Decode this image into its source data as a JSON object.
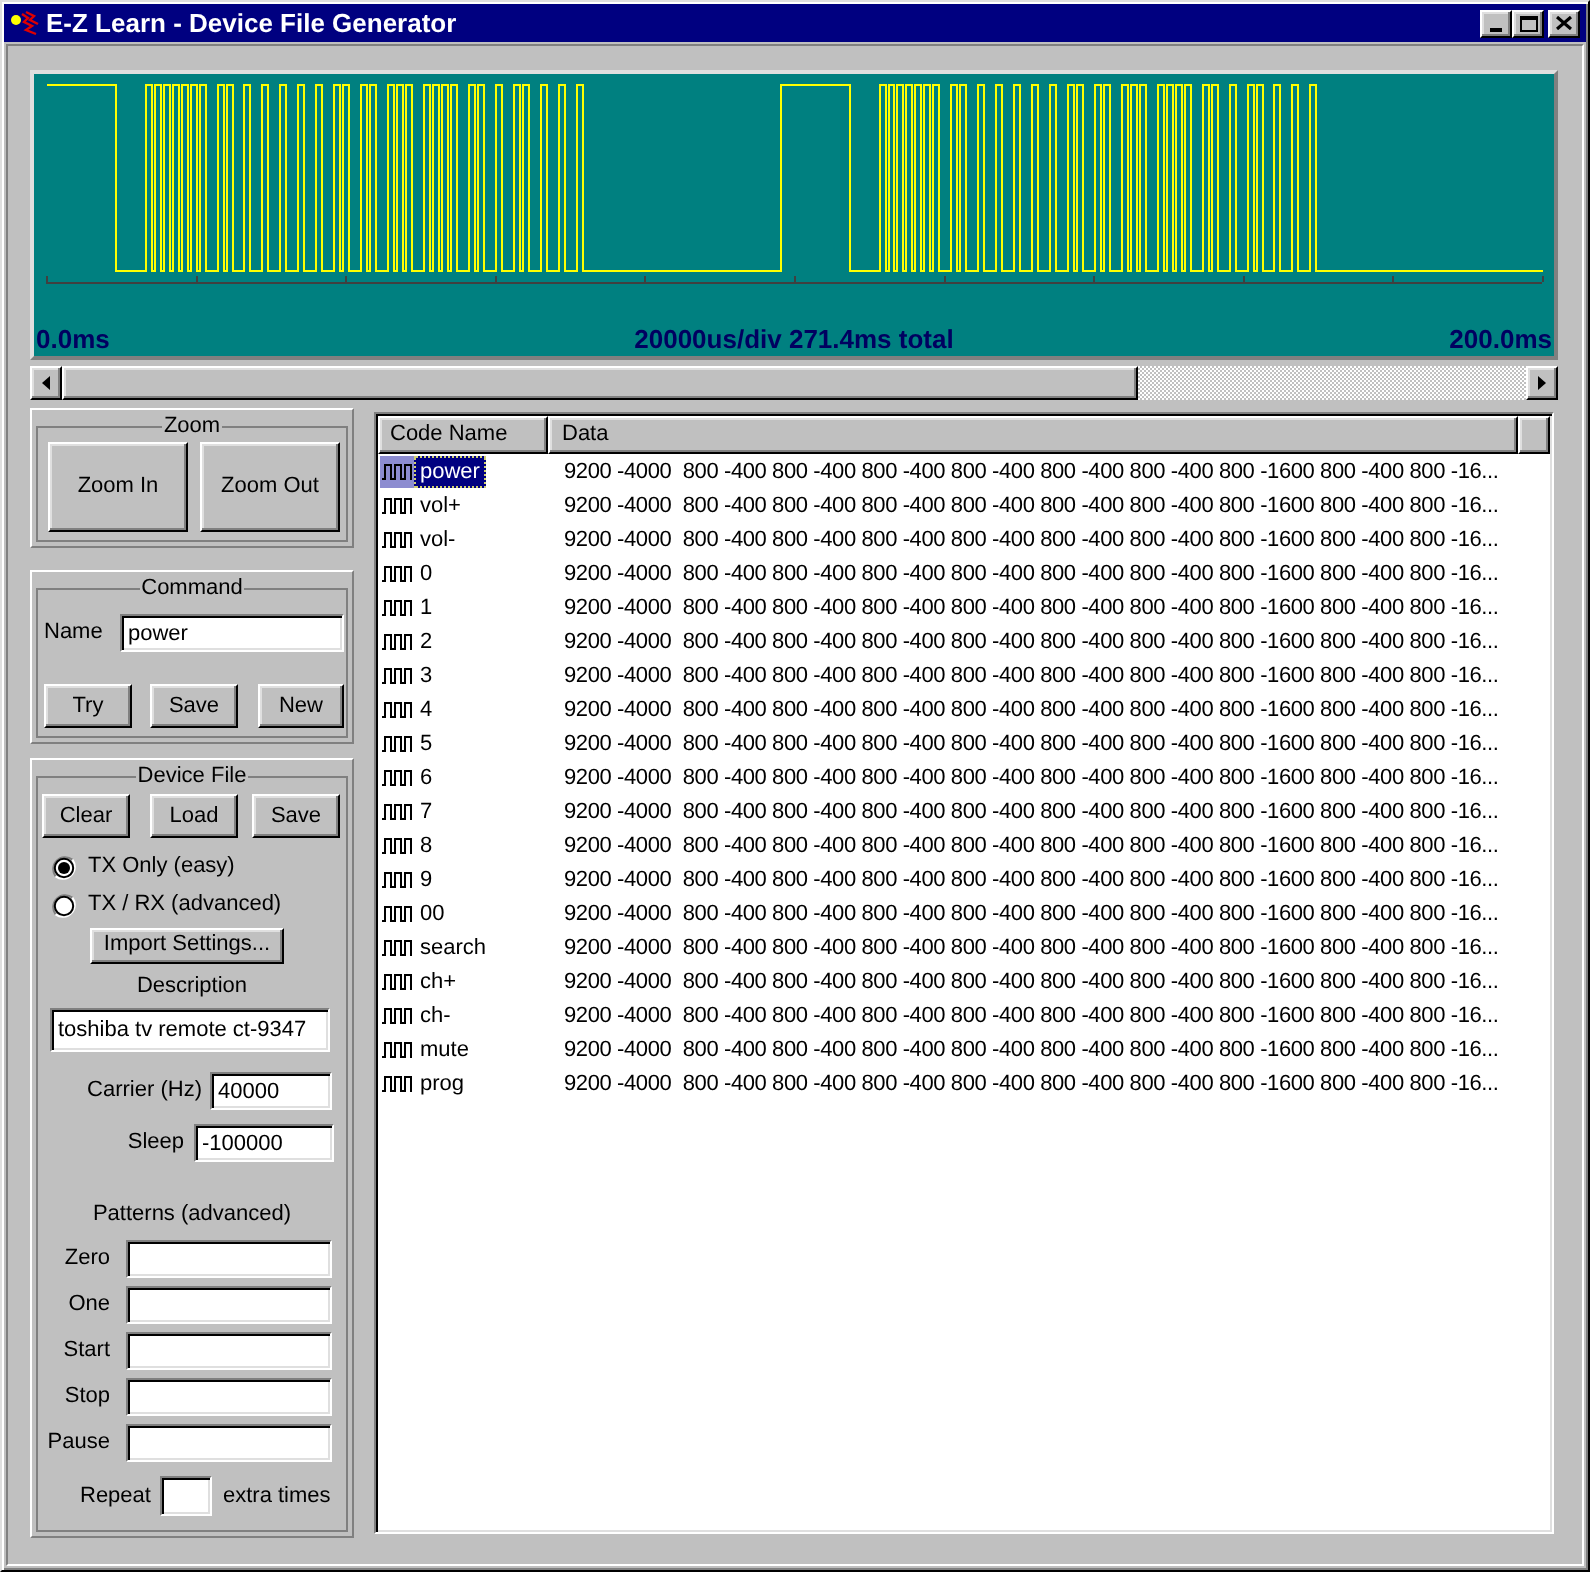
{
  "window": {
    "title": "E-Z Learn - Device File Generator"
  },
  "waveform": {
    "start_label": "0.0ms",
    "scale_label": "20000us/div 271.4ms total",
    "end_label": "200.0ms"
  },
  "zoom": {
    "title": "Zoom",
    "buttons": [
      "Zoom In",
      "Zoom Out"
    ]
  },
  "command": {
    "title": "Command",
    "name_label": "Name",
    "name_value": "power",
    "buttons": [
      "Try",
      "Save",
      "New"
    ]
  },
  "device_file": {
    "title": "Device File",
    "buttons": [
      "Clear",
      "Load",
      "Save"
    ],
    "modes": [
      {
        "label": "TX Only (easy)",
        "selected": true
      },
      {
        "label": "TX / RX (advanced)",
        "selected": false
      }
    ],
    "import_button": "Import Settings...",
    "description_label": "Description",
    "description_value": "toshiba tv remote ct-9347",
    "carrier_label": "Carrier (Hz)",
    "carrier_value": "40000",
    "sleep_label": "Sleep",
    "sleep_value": "-100000",
    "patterns_title": "Patterns (advanced)",
    "patterns": [
      {
        "label": "Zero"
      },
      {
        "label": "One"
      },
      {
        "label": "Start"
      },
      {
        "label": "Stop"
      },
      {
        "label": "Pause"
      }
    ],
    "repeat_label": "Repeat",
    "repeat_suffix": "extra times"
  },
  "table": {
    "columns": [
      "Code Name",
      "Data"
    ],
    "rows": [
      {
        "name": "power",
        "data": "9200 -4000  800 -400 800 -400 800 -400 800 -400 800 -400 800 -400 800 -1600 800 -400 800 -16...",
        "selected": true
      },
      {
        "name": "vol+",
        "data": "9200 -4000  800 -400 800 -400 800 -400 800 -400 800 -400 800 -400 800 -1600 800 -400 800 -16...",
        "selected": false
      },
      {
        "name": "vol-",
        "data": "9200 -4000  800 -400 800 -400 800 -400 800 -400 800 -400 800 -400 800 -1600 800 -400 800 -16...",
        "selected": false
      },
      {
        "name": "0",
        "data": "9200 -4000  800 -400 800 -400 800 -400 800 -400 800 -400 800 -400 800 -1600 800 -400 800 -16...",
        "selected": false
      },
      {
        "name": "1",
        "data": "9200 -4000  800 -400 800 -400 800 -400 800 -400 800 -400 800 -400 800 -1600 800 -400 800 -16...",
        "selected": false
      },
      {
        "name": "2",
        "data": "9200 -4000  800 -400 800 -400 800 -400 800 -400 800 -400 800 -400 800 -1600 800 -400 800 -16...",
        "selected": false
      },
      {
        "name": "3",
        "data": "9200 -4000  800 -400 800 -400 800 -400 800 -400 800 -400 800 -400 800 -1600 800 -400 800 -16...",
        "selected": false
      },
      {
        "name": "4",
        "data": "9200 -4000  800 -400 800 -400 800 -400 800 -400 800 -400 800 -400 800 -1600 800 -400 800 -16...",
        "selected": false
      },
      {
        "name": "5",
        "data": "9200 -4000  800 -400 800 -400 800 -400 800 -400 800 -400 800 -400 800 -1600 800 -400 800 -16...",
        "selected": false
      },
      {
        "name": "6",
        "data": "9200 -4000  800 -400 800 -400 800 -400 800 -400 800 -400 800 -400 800 -1600 800 -400 800 -16...",
        "selected": false
      },
      {
        "name": "7",
        "data": "9200 -4000  800 -400 800 -400 800 -400 800 -400 800 -400 800 -400 800 -1600 800 -400 800 -16...",
        "selected": false
      },
      {
        "name": "8",
        "data": "9200 -4000  800 -400 800 -400 800 -400 800 -400 800 -400 800 -400 800 -1600 800 -400 800 -16...",
        "selected": false
      },
      {
        "name": "9",
        "data": "9200 -4000  800 -400 800 -400 800 -400 800 -400 800 -400 800 -400 800 -1600 800 -400 800 -16...",
        "selected": false
      },
      {
        "name": "00",
        "data": "9200 -4000  800 -400 800 -400 800 -400 800 -400 800 -400 800 -400 800 -1600 800 -400 800 -16...",
        "selected": false
      },
      {
        "name": "search",
        "data": "9200 -4000  800 -400 800 -400 800 -400 800 -400 800 -400 800 -400 800 -1600 800 -400 800 -16...",
        "selected": false
      },
      {
        "name": "ch+",
        "data": "9200 -4000  800 -400 800 -400 800 -400 800 -400 800 -400 800 -400 800 -1600 800 -400 800 -16...",
        "selected": false
      },
      {
        "name": "ch-",
        "data": "9200 -4000  800 -400 800 -400 800 -400 800 -400 800 -400 800 -400 800 -1600 800 -400 800 -16...",
        "selected": false
      },
      {
        "name": "mute",
        "data": "9200 -4000  800 -400 800 -400 800 -400 800 -400 800 -400 800 -400 800 -1600 800 -400 800 -16...",
        "selected": false
      },
      {
        "name": "prog",
        "data": "9200 -4000  800 -400 800 -400 800 -400 800 -400 800 -400 800 -400 800 -1600 800 -400 800 -16...",
        "selected": false
      }
    ]
  }
}
